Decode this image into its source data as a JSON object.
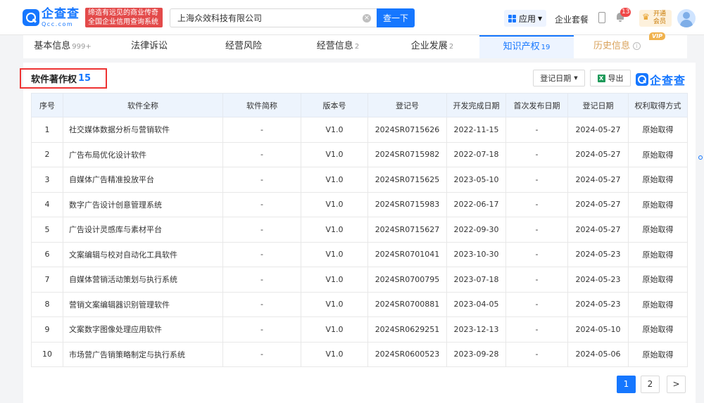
{
  "header": {
    "logo_cn": "企查查",
    "logo_en": "Qcc.com",
    "slogan": [
      "缔造有远见的商业传奇",
      "全国企业信用查询系统"
    ],
    "search_value": "上海众效科技有限公司",
    "search_button": "查一下",
    "app_label": "应用",
    "package_label": "企业套餐",
    "notification_count": "13",
    "vip_open": [
      "开通",
      "会员"
    ]
  },
  "tabs": [
    {
      "label": "基本信息",
      "count": "999+"
    },
    {
      "label": "法律诉讼",
      "count": ""
    },
    {
      "label": "经营风险",
      "count": ""
    },
    {
      "label": "经营信息",
      "count": "2"
    },
    {
      "label": "企业发展",
      "count": "2"
    },
    {
      "label": "知识产权",
      "count": "19"
    },
    {
      "label": "历史信息",
      "count": ""
    }
  ],
  "vip_tag": "VIP",
  "section": {
    "title": "软件著作权",
    "count": "15",
    "sort_label": "登记日期",
    "export_label": "导出",
    "brand": "企查查"
  },
  "table": {
    "headers": [
      "序号",
      "软件全称",
      "软件简称",
      "版本号",
      "登记号",
      "开发完成日期",
      "首次发布日期",
      "登记日期",
      "权利取得方式"
    ],
    "rows": [
      [
        "1",
        "社交媒体数据分析与营销软件",
        "-",
        "V1.0",
        "2024SR0715626",
        "2022-11-15",
        "-",
        "2024-05-27",
        "原始取得"
      ],
      [
        "2",
        "广告布局优化设计软件",
        "-",
        "V1.0",
        "2024SR0715982",
        "2022-07-18",
        "-",
        "2024-05-27",
        "原始取得"
      ],
      [
        "3",
        "自媒体广告精准投放平台",
        "-",
        "V1.0",
        "2024SR0715625",
        "2023-05-10",
        "-",
        "2024-05-27",
        "原始取得"
      ],
      [
        "4",
        "数字广告设计创意管理系统",
        "-",
        "V1.0",
        "2024SR0715983",
        "2022-06-17",
        "-",
        "2024-05-27",
        "原始取得"
      ],
      [
        "5",
        "广告设计灵感库与素材平台",
        "-",
        "V1.0",
        "2024SR0715627",
        "2022-09-30",
        "-",
        "2024-05-27",
        "原始取得"
      ],
      [
        "6",
        "文案编辑与校对自动化工具软件",
        "-",
        "V1.0",
        "2024SR0701041",
        "2023-10-30",
        "-",
        "2024-05-23",
        "原始取得"
      ],
      [
        "7",
        "自媒体营销活动策划与执行系统",
        "-",
        "V1.0",
        "2024SR0700795",
        "2023-07-18",
        "-",
        "2024-05-23",
        "原始取得"
      ],
      [
        "8",
        "营销文案编辑器识别管理软件",
        "-",
        "V1.0",
        "2024SR0700881",
        "2023-04-05",
        "-",
        "2024-05-23",
        "原始取得"
      ],
      [
        "9",
        "文案数字图像处理应用软件",
        "-",
        "V1.0",
        "2024SR0629251",
        "2023-12-13",
        "-",
        "2024-05-10",
        "原始取得"
      ],
      [
        "10",
        "市场营广告销策略制定与执行系统",
        "-",
        "V1.0",
        "2024SR0600523",
        "2023-09-28",
        "-",
        "2024-05-06",
        "原始取得"
      ]
    ]
  },
  "pagination": {
    "pages": [
      "1",
      "2"
    ],
    "current": "1",
    "next": ">"
  }
}
